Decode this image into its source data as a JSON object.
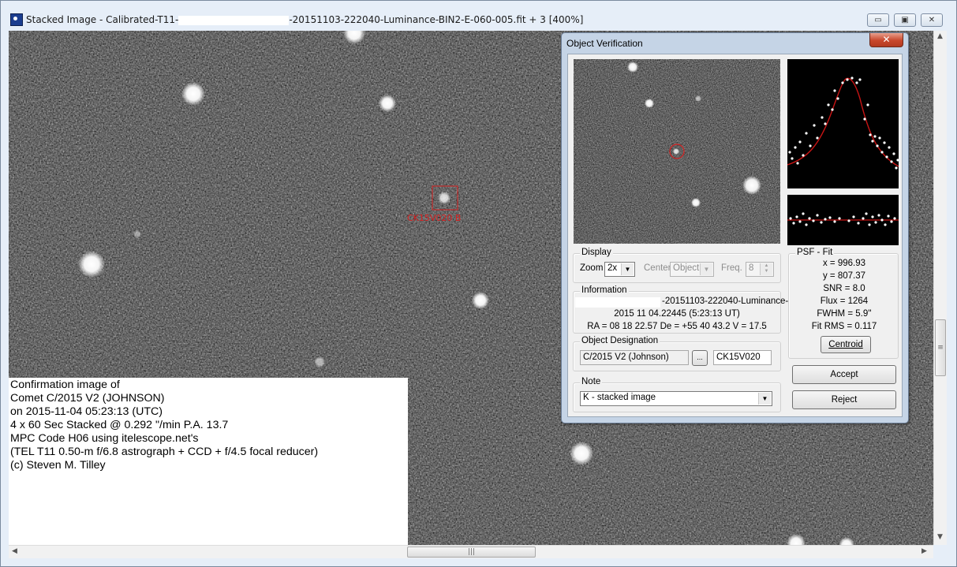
{
  "window": {
    "title_prefix": "Stacked Image - Calibrated-T11-",
    "title_suffix": "-20151103-222040-Luminance-BIN2-E-060-005.fit + 3 [400%]",
    "minimize_glyph": "▭",
    "maximize_glyph": "▣",
    "close_glyph": "✕"
  },
  "image": {
    "target_label": "CK15V020 B",
    "caption": [
      "Confirmation image of",
      "Comet C/2015 V2 (JOHNSON)",
      "on 2015-11-04 05:23:13 (UTC)",
      "4 x 60 Sec Stacked @ 0.292 \"/min P.A. 13.7",
      "MPC Code H06 using itelescope.net's",
      "(TEL T11 0.50-m f/6.8 astrograph + CCD + f/4.5 focal reducer)",
      "(c) Steven M. Tilley"
    ]
  },
  "dialog": {
    "title": "Object Verification",
    "close_glyph": "✕",
    "display": {
      "legend": "Display",
      "zoom_label": "Zoom",
      "zoom_value": "2x",
      "center_label": "Center",
      "center_value": "Object",
      "freq_label": "Freq.",
      "freq_value": "8"
    },
    "information": {
      "legend": "Information",
      "line1": "-20151103-222040-Luminance-",
      "line2": "2015 11 04.22445 (5:23:13 UT)",
      "line3": "RA = 08 18 22.57   De = +55 40 43.2   V = 17.5"
    },
    "designation": {
      "legend": "Object Designation",
      "name": "C/2015 V2 (Johnson)",
      "browse_glyph": "...",
      "code": "CK15V020"
    },
    "note": {
      "legend": "Note",
      "value": "K - stacked image"
    },
    "psf": {
      "legend": "PSF - Fit",
      "x": "x = 996.93",
      "y": "y = 807.37",
      "snr": "SNR = 8.0",
      "flux": "Flux = 1264",
      "fwhm": "FWHM = 5.9''",
      "rms": "Fit RMS = 0.117",
      "centroid_label": "Centroid"
    },
    "accept_label": "Accept",
    "reject_label": "Reject"
  },
  "icons": [
    "app-icon",
    "minimize-icon",
    "maximize-icon",
    "close-icon",
    "chevron-down-icon",
    "ellipsis-icon",
    "spin-up-icon",
    "spin-down-icon",
    "arrow-left-icon",
    "arrow-right-icon",
    "arrow-up-icon",
    "arrow-down-icon"
  ],
  "colors": {
    "marker_red": "#d42020",
    "psf_curve": "#c81414",
    "caption_bg": "#ffffff",
    "dialog_frame": "#c5d4e6"
  }
}
